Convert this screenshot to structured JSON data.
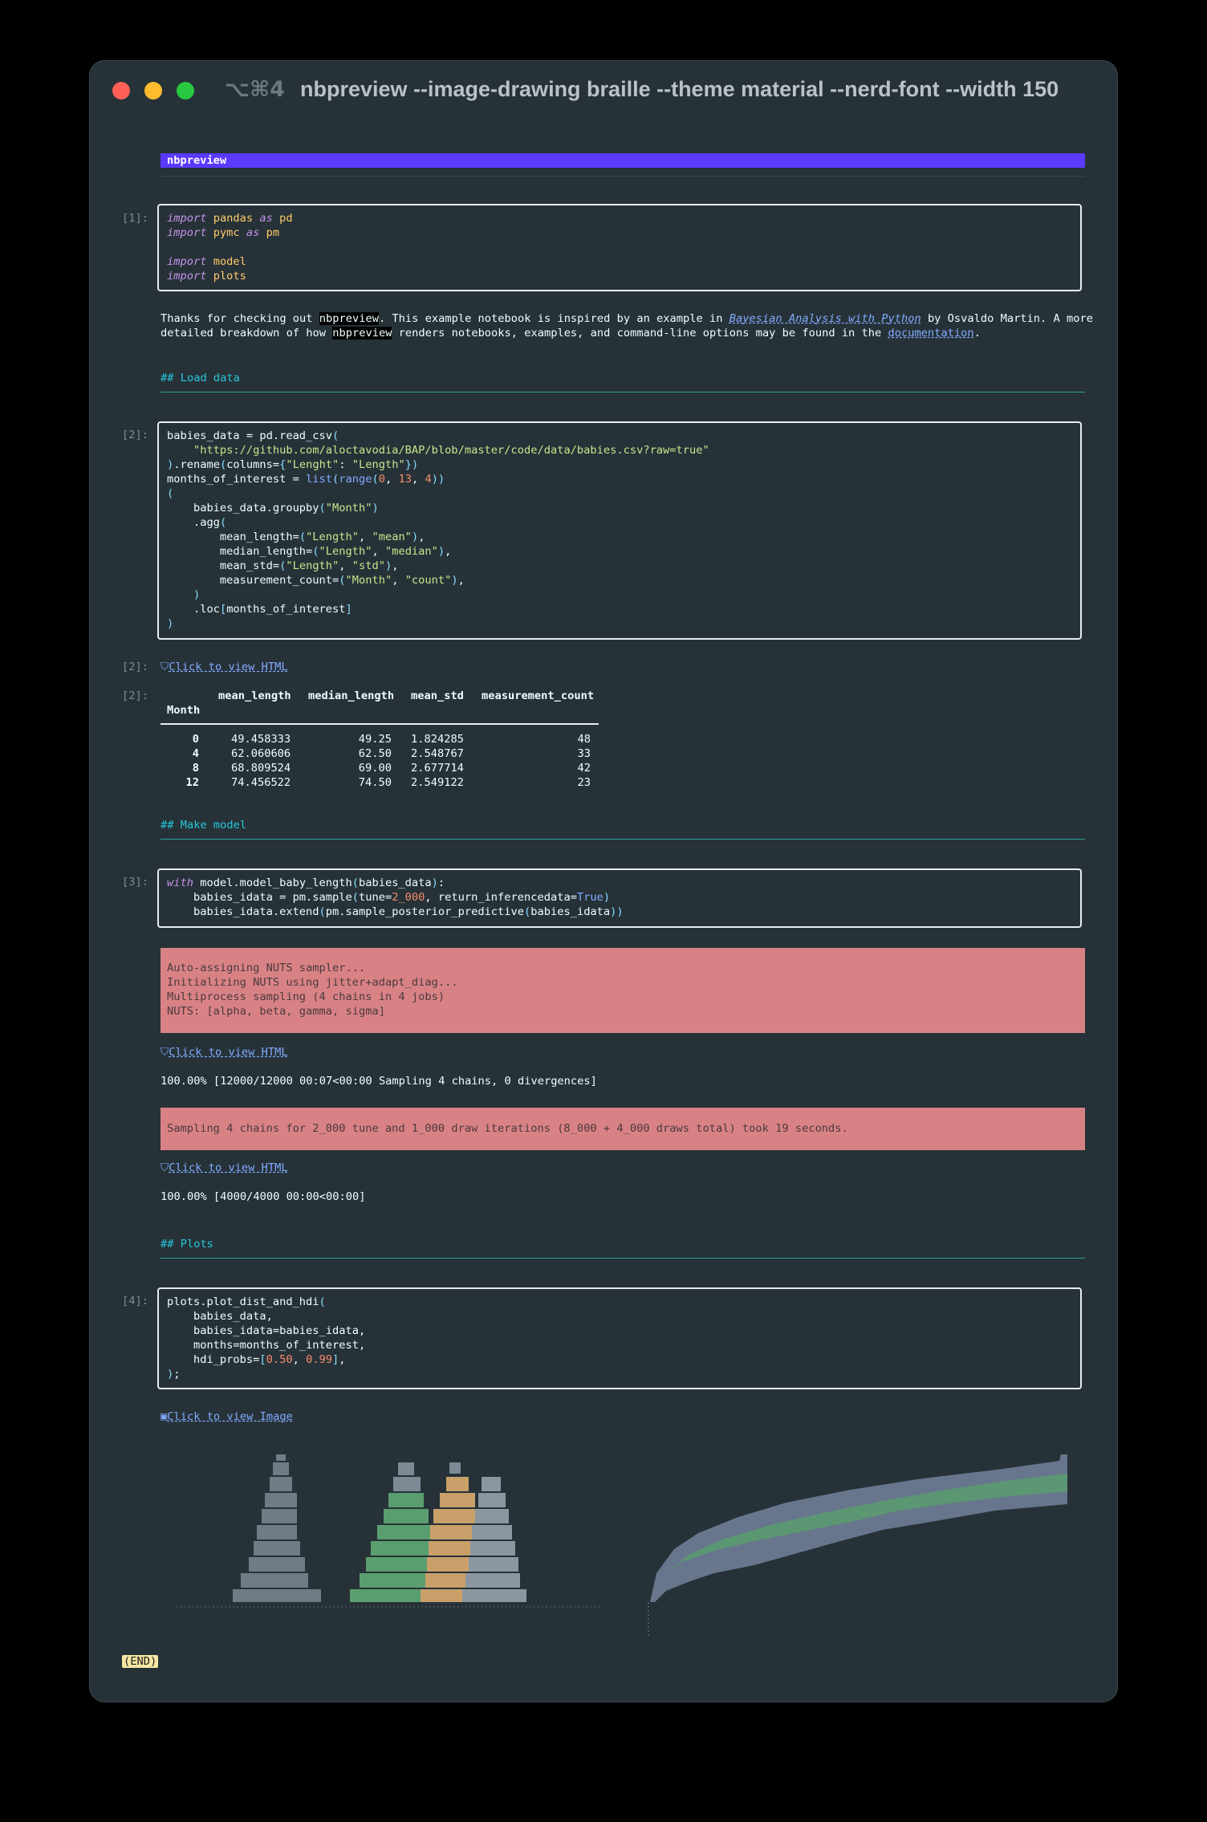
{
  "window": {
    "shortcut": "⌥⌘4",
    "title": "nbpreview --image-drawing braille --theme material --nerd-font --width 150",
    "traffic_lights": {
      "close": "#ff5f57",
      "minimize": "#febc2e",
      "zoom": "#28c840"
    }
  },
  "header": {
    "name": "nbpreview"
  },
  "cells": {
    "c1": {
      "prompt": "[1]:"
    },
    "intro": {
      "l1_a": "Thanks for checking out ",
      "l1_b": "nbpreview",
      "l1_c": ". This example notebook is inspired by an example in ",
      "l1_d": "Bayesian Analysis with Python",
      "l1_e": " by Osvaldo Martin. A more",
      "l2_a": "detailed breakdown of how ",
      "l2_b": "nbpreview",
      "l2_c": " renders notebooks, examples, and command-line options may be found in the ",
      "l2_d": "documentation",
      "l2_e": "."
    },
    "h_load": "## Load data",
    "c2": {
      "prompt": "[2]:"
    },
    "out2_html": {
      "prompt": "[2]:",
      "link": "Click to view HTML"
    },
    "table": {
      "prompt": "[2]:",
      "index_name": "Month",
      "columns": [
        "mean_length",
        "median_length",
        "mean_std",
        "measurement_count"
      ],
      "rows": [
        {
          "idx": "0",
          "mean_length": "49.458333",
          "median_length": "49.25",
          "mean_std": "1.824285",
          "count": "48"
        },
        {
          "idx": "4",
          "mean_length": "62.060606",
          "median_length": "62.50",
          "mean_std": "2.548767",
          "count": "33"
        },
        {
          "idx": "8",
          "mean_length": "68.809524",
          "median_length": "69.00",
          "mean_std": "2.677714",
          "count": "42"
        },
        {
          "idx": "12",
          "mean_length": "74.456522",
          "median_length": "74.50",
          "mean_std": "2.549122",
          "count": "23"
        }
      ]
    },
    "h_model": "## Make model",
    "c3": {
      "prompt": "[3]:"
    },
    "stderr1": [
      "Auto-assigning NUTS sampler...",
      "Initializing NUTS using jitter+adapt_diag...",
      "Multiprocess sampling (4 chains in 4 jobs)",
      "NUTS: [alpha, beta, gamma, sigma]"
    ],
    "link_a": "Click to view HTML",
    "progress1": "100.00% [12000/12000 00:07<00:00 Sampling 4 chains, 0 divergences]",
    "stderr2": "Sampling 4 chains for 2_000 tune and 1_000 draw iterations (8_000 + 4_000 draws total) took 19 seconds.",
    "link_b": "Click to view HTML",
    "progress2": "100.00% [4000/4000 00:00<00:00]",
    "h_plots": "## Plots",
    "c4": {
      "prompt": "[4]:"
    },
    "image_link": "Click to view Image",
    "end": "(END)"
  },
  "icons": {
    "html": "html-file-icon",
    "image": "image-file-icon"
  }
}
